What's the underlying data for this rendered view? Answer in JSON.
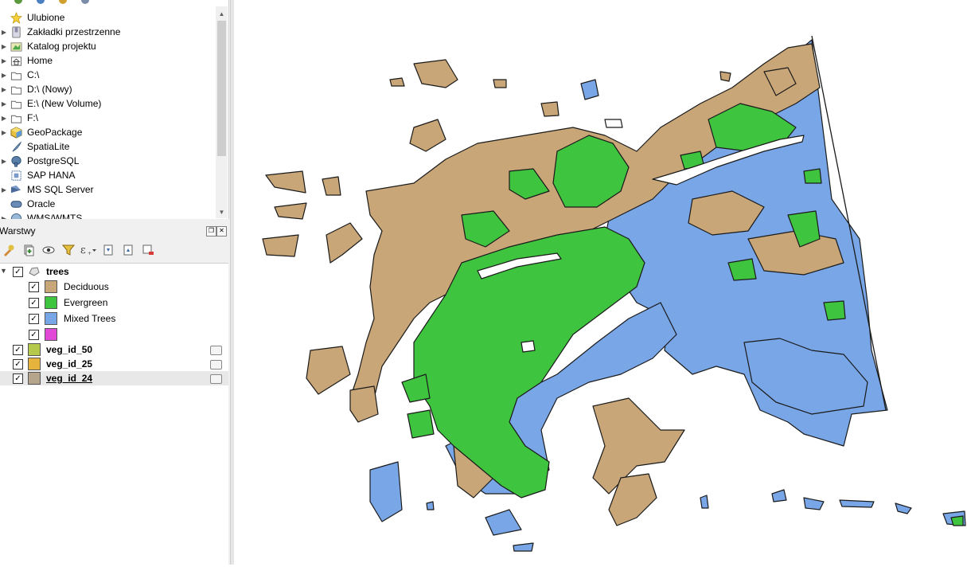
{
  "browser": {
    "items": [
      {
        "label": "Ulubione",
        "icon": "star-icon",
        "expandable": false
      },
      {
        "label": "Zakładki przestrzenne",
        "icon": "bookmark-icon",
        "expandable": true
      },
      {
        "label": "Katalog projektu",
        "icon": "project-folder-icon",
        "expandable": true
      },
      {
        "label": "Home",
        "icon": "home-folder-icon",
        "expandable": true
      },
      {
        "label": "C:\\",
        "icon": "folder-icon",
        "expandable": true
      },
      {
        "label": "D:\\ (Nowy)",
        "icon": "folder-icon",
        "expandable": true
      },
      {
        "label": "E:\\ (New Volume)",
        "icon": "folder-icon",
        "expandable": true
      },
      {
        "label": "F:\\",
        "icon": "folder-icon",
        "expandable": true
      },
      {
        "label": "GeoPackage",
        "icon": "geopackage-icon",
        "expandable": true
      },
      {
        "label": "SpatiaLite",
        "icon": "spatialite-icon",
        "expandable": false
      },
      {
        "label": "PostgreSQL",
        "icon": "postgresql-icon",
        "expandable": true
      },
      {
        "label": "SAP HANA",
        "icon": "sap-hana-icon",
        "expandable": false
      },
      {
        "label": "MS SQL Server",
        "icon": "mssql-icon",
        "expandable": true
      },
      {
        "label": "Oracle",
        "icon": "oracle-icon",
        "expandable": false
      },
      {
        "label": "WMS/WMTS",
        "icon": "wms-icon",
        "expandable": true
      }
    ]
  },
  "layers_panel": {
    "title": "Warstwy",
    "float_symbol": "❐",
    "close_symbol": "✕",
    "layers": [
      {
        "name": "trees",
        "checked": true,
        "bold": true,
        "expanded": true,
        "icon": "polygon-layer-icon",
        "classes": [
          {
            "label": "Deciduous",
            "color": "#c8a678",
            "checked": true
          },
          {
            "label": "Evergreen",
            "color": "#3ec43e",
            "checked": true
          },
          {
            "label": "Mixed Trees",
            "color": "#79a6e6",
            "checked": true
          },
          {
            "label": "",
            "color": "#e04ad6",
            "checked": true
          }
        ]
      },
      {
        "name": "veg_id_50",
        "checked": true,
        "bold": true,
        "color": "#b5c94c"
      },
      {
        "name": "veg_id_25",
        "checked": true,
        "bold": true,
        "color": "#e6b33c"
      },
      {
        "name": "veg_id_24",
        "checked": true,
        "bold": true,
        "color": "#b4a58c",
        "selected": true
      }
    ]
  },
  "map": {
    "colors": {
      "deciduous": "#c8a678",
      "evergreen": "#3ec43e",
      "mixed": "#79a6e6",
      "outline": "#1a1a1a"
    }
  }
}
